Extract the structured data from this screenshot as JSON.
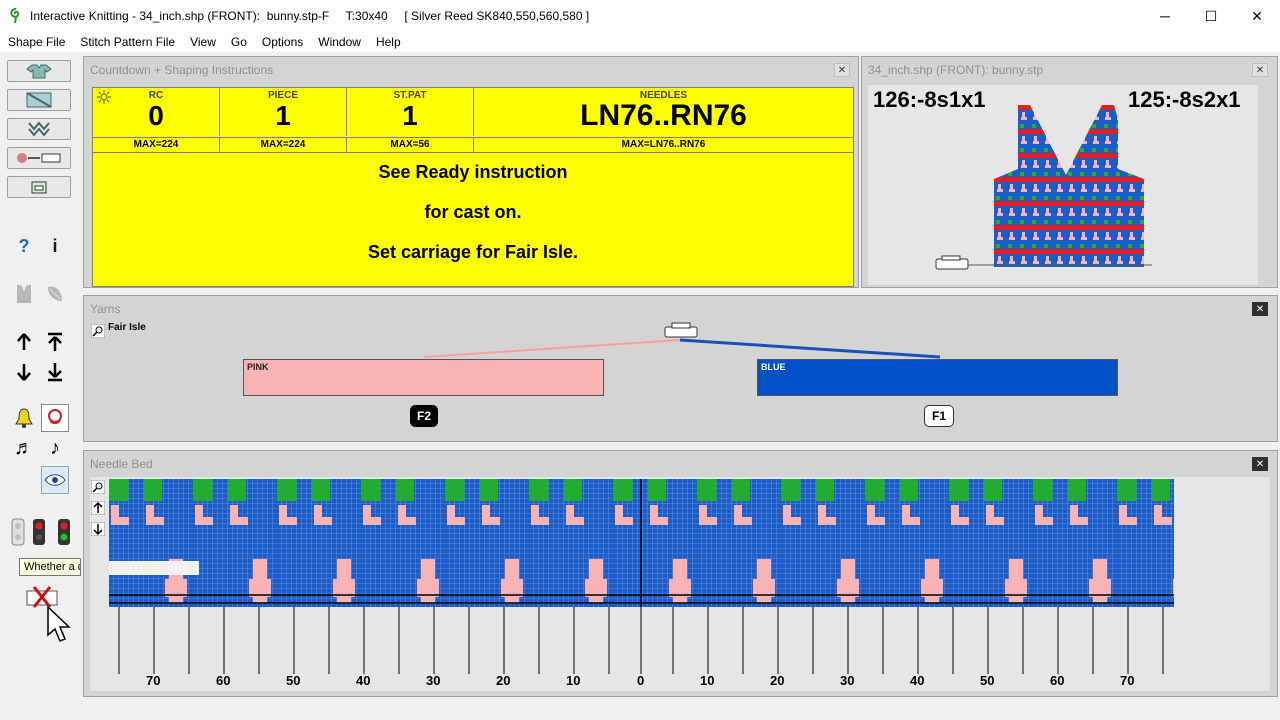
{
  "window": {
    "title": "Interactive Knitting - 34_inch.shp (FRONT):  bunny.stp-F     T:30x40     [ Silver Reed SK840,550,560,580 ]",
    "minimize": "─",
    "maximize": "☐",
    "close": "✕"
  },
  "menu": [
    "Shape File",
    "Stitch Pattern File",
    "View",
    "Go",
    "Options",
    "Window",
    "Help"
  ],
  "countdown": {
    "title": "Countdown + Shaping Instructions",
    "cells": [
      {
        "label": "RC",
        "value": "0",
        "max": "MAX=224"
      },
      {
        "label": "PIECE",
        "value": "1",
        "max": "MAX=224"
      },
      {
        "label": "ST.PAT",
        "value": "1",
        "max": "MAX=56"
      },
      {
        "label": "NEEDLES",
        "value": "LN76..RN76",
        "max": "MAX=LN76..RN76"
      }
    ],
    "instructions": [
      "See Ready instruction",
      "for cast on.",
      "Set carriage for Fair Isle."
    ]
  },
  "preview": {
    "title": "34_inch.shp (FRONT):  bunny.stp",
    "left_label": "126:-8s1x1",
    "right_label": "125:-8s2x1"
  },
  "yarns": {
    "title": "Yarns",
    "mode": "Fair Isle",
    "yarn1": {
      "name": "PINK",
      "feeder": "F2",
      "color": "#f8b4b4"
    },
    "yarn2": {
      "name": "BLUE",
      "feeder": "F1",
      "color": "#0050c8"
    }
  },
  "needlebed": {
    "title": "Needle Bed",
    "numbers": [
      "70",
      "60",
      "50",
      "40",
      "30",
      "20",
      "10",
      "0",
      "10",
      "20",
      "30",
      "40",
      "50",
      "60",
      "70"
    ]
  },
  "tooltip": "Whether a c",
  "toolbar": {
    "help": "?",
    "info": "i"
  },
  "colors": {
    "blue": "#1a5cc8",
    "pink": "#f8b4b4",
    "green": "#22b422",
    "yellow": "#ffff00"
  }
}
